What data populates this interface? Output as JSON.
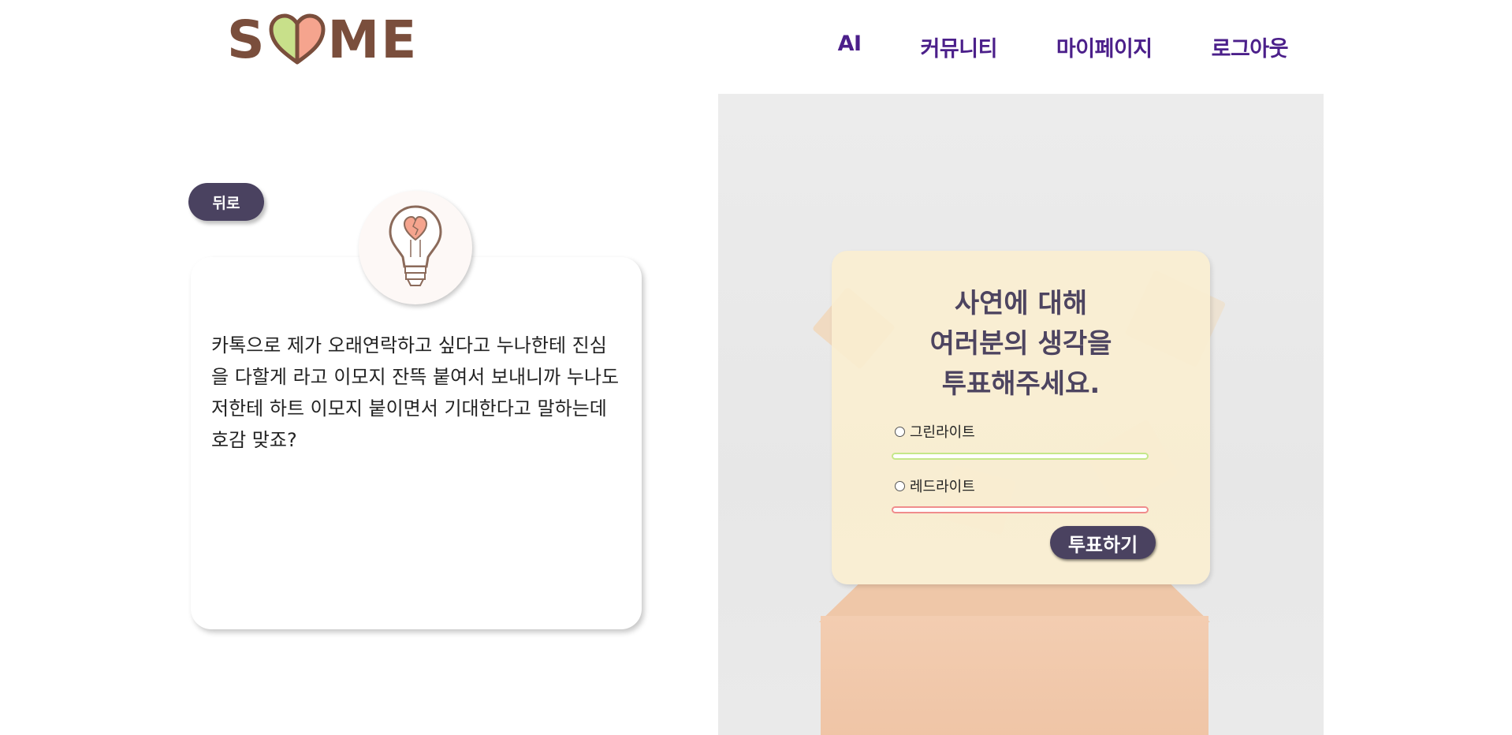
{
  "header": {
    "logo": {
      "left_text": "S",
      "right_text": "ME",
      "heart_colors": {
        "left": "#c8e08a",
        "right": "#f5a48e",
        "outline": "#7a4e3c"
      },
      "text_color": "#7a4e3c"
    },
    "nav": [
      {
        "label": "AI"
      },
      {
        "label": "커뮤니티"
      },
      {
        "label": "마이페이지"
      },
      {
        "label": "로그아웃"
      }
    ],
    "nav_color": "#4b1f8a"
  },
  "story": {
    "back_label": "뒤로",
    "icon": "lightbulb-heart-icon",
    "text": "카톡으로 제가 오래연락하고 싶다고 누나한테 진심을 다할게 라고 이모지 잔뜩 붙여서 보내니까 누나도 저한테 하트 이모지 붙이면서 기대한다고 말하는데 호감 맞죠?"
  },
  "vote": {
    "title_lines": [
      "사연에 대해",
      "여러분의 생각을",
      "투표해주세요."
    ],
    "options": [
      {
        "label": "그린라이트",
        "selected": false,
        "color": "#c5e78a"
      },
      {
        "label": "레드라이트",
        "selected": false,
        "color": "#f08c8c"
      }
    ],
    "submit_label": "투표하기",
    "accent": "#4a4260"
  }
}
